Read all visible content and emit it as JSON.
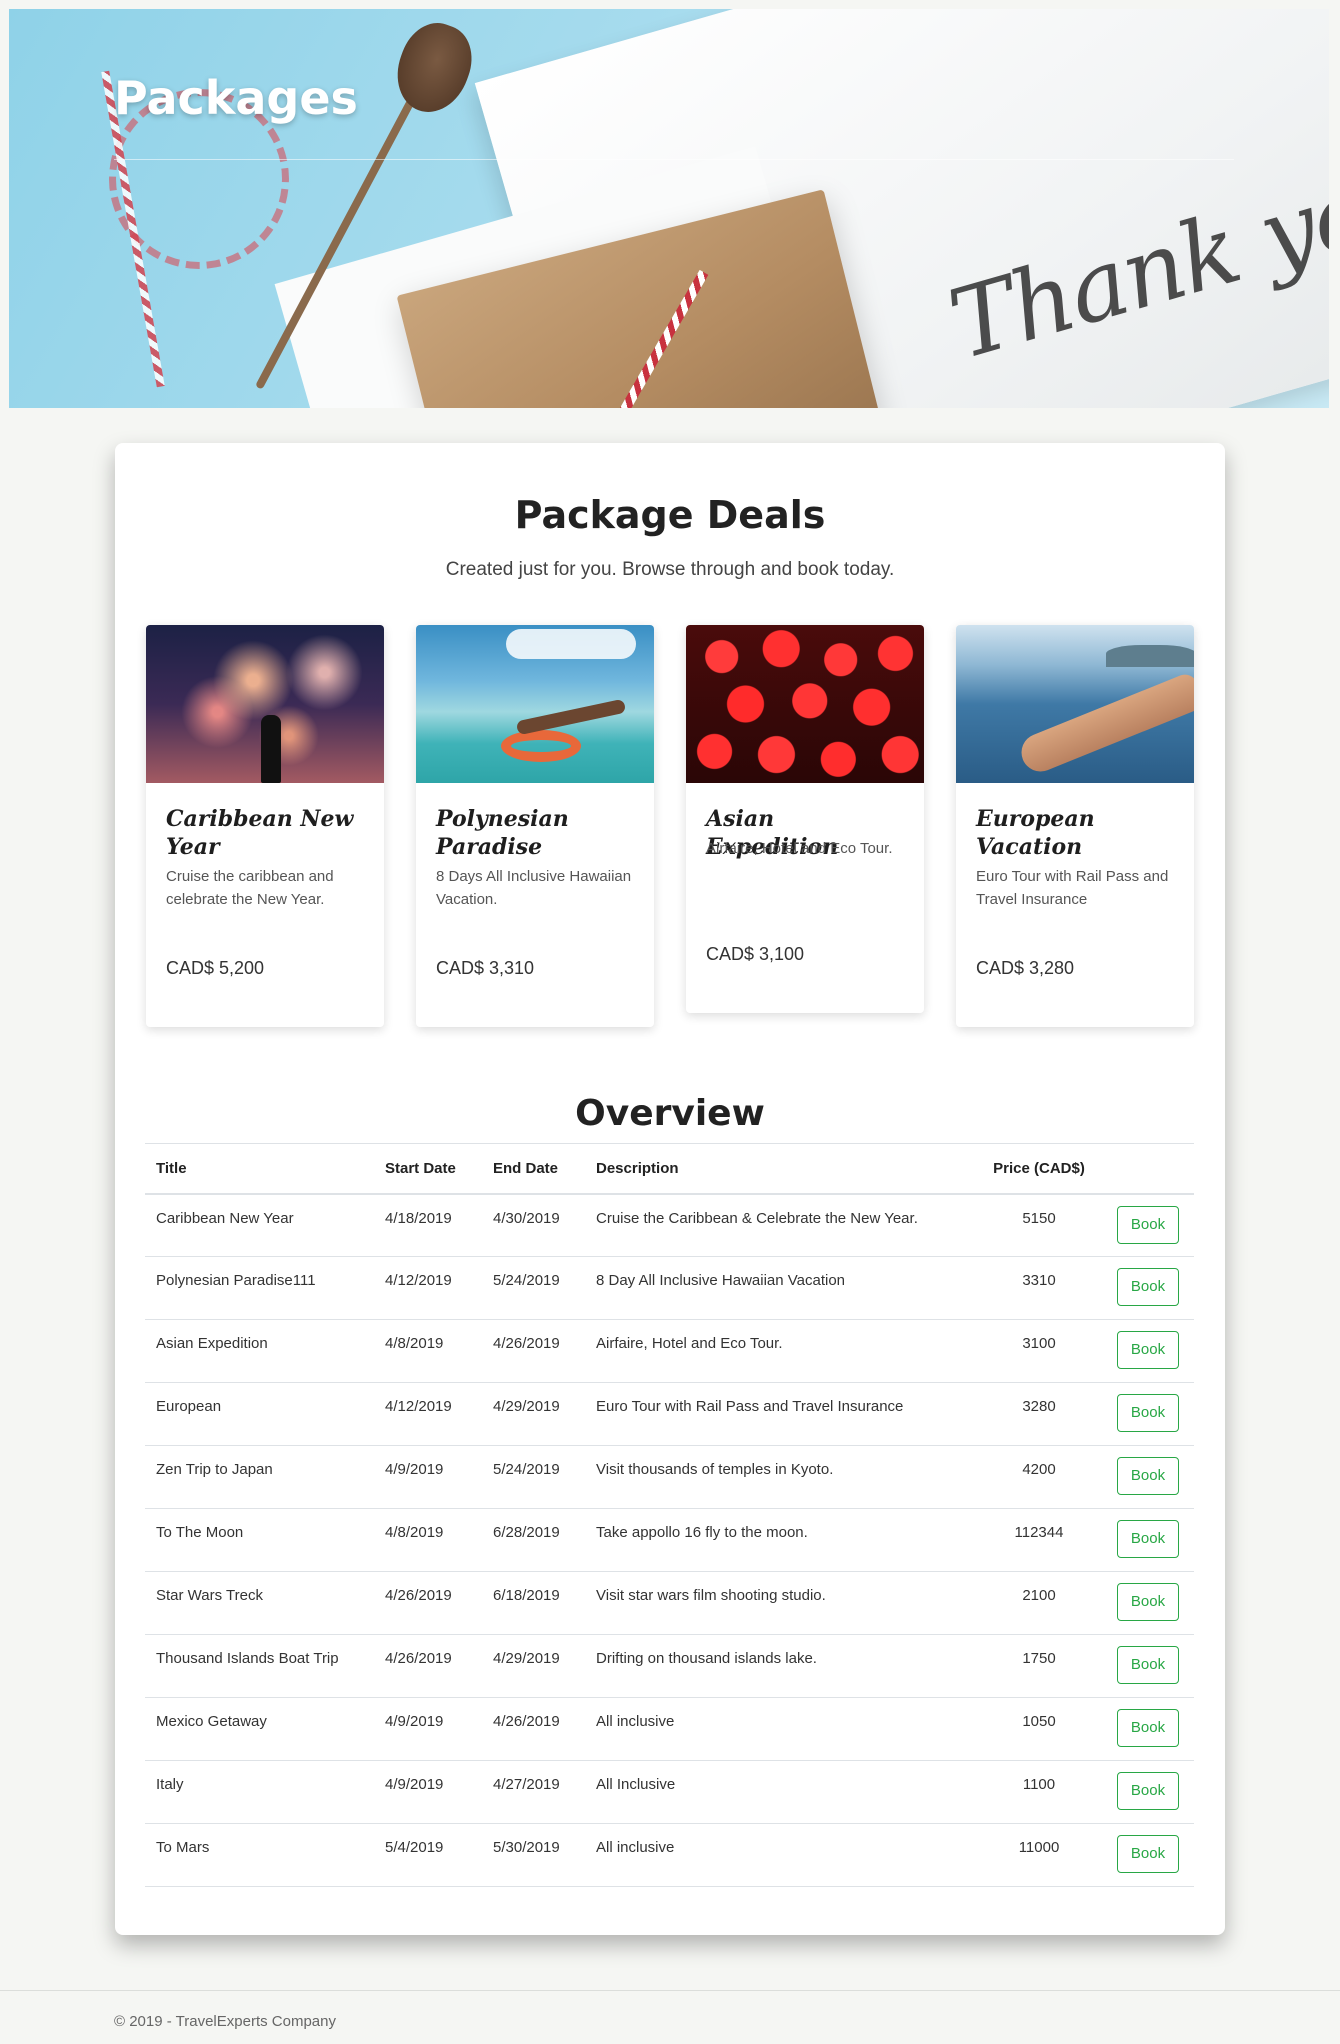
{
  "hero": {
    "title": "Packages"
  },
  "deals": {
    "heading": "Package Deals",
    "subtitle": "Created just for you. Browse through and book today."
  },
  "packages": [
    {
      "title": "Caribbean New Year",
      "description": "Cruise the caribbean and celebrate the New Year.",
      "price": "CAD$ 5,200",
      "image": "fireworks-photo"
    },
    {
      "title": "Polynesian Paradise",
      "description": "8 Days All Inclusive Hawaiian Vacation.",
      "price": "CAD$ 3,310",
      "image": "pool-float-photo"
    },
    {
      "title": "Asian Expedition",
      "description": "Airfaire, Hotel and Eco Tour.",
      "price": "CAD$ 3,100",
      "image": "red-lanterns-photo"
    },
    {
      "title": "European Vacation",
      "description": "Euro Tour with Rail Pass and Travel Insurance",
      "price": "CAD$ 3,280",
      "image": "sea-hand-photo"
    }
  ],
  "overview": {
    "heading": "Overview",
    "columns": [
      "Title",
      "Start Date",
      "End Date",
      "Description",
      "Price (CAD$)",
      ""
    ],
    "book_label": "Book",
    "rows": [
      {
        "title": "Caribbean New Year",
        "start": "4/18/2019",
        "end": "4/30/2019",
        "description": "Cruise the Caribbean & Celebrate the New Year.",
        "price": "5150"
      },
      {
        "title": "Polynesian Paradise111",
        "start": "4/12/2019",
        "end": "5/24/2019",
        "description": "8 Day All Inclusive Hawaiian Vacation",
        "price": "3310"
      },
      {
        "title": "Asian Expedition",
        "start": "4/8/2019",
        "end": "4/26/2019",
        "description": "Airfaire, Hotel and Eco Tour.",
        "price": "3100"
      },
      {
        "title": "European",
        "start": "4/12/2019",
        "end": "4/29/2019",
        "description": "Euro Tour with Rail Pass and Travel Insurance",
        "price": "3280"
      },
      {
        "title": "Zen Trip to Japan",
        "start": "4/9/2019",
        "end": "5/24/2019",
        "description": "Visit thousands of temples in Kyoto.",
        "price": "4200"
      },
      {
        "title": "To The Moon",
        "start": "4/8/2019",
        "end": "6/28/2019",
        "description": "Take appollo 16 fly to the moon.",
        "price": "112344"
      },
      {
        "title": "Star Wars Treck",
        "start": "4/26/2019",
        "end": "6/18/2019",
        "description": "Visit star wars film shooting studio.",
        "price": "2100"
      },
      {
        "title": "Thousand Islands Boat Trip",
        "start": "4/26/2019",
        "end": "4/29/2019",
        "description": "Drifting on thousand islands lake.",
        "price": "1750"
      },
      {
        "title": "Mexico Getaway",
        "start": "4/9/2019",
        "end": "4/26/2019",
        "description": "All inclusive",
        "price": "1050"
      },
      {
        "title": "Italy",
        "start": "4/9/2019",
        "end": "4/27/2019",
        "description": "All Inclusive",
        "price": "1100"
      },
      {
        "title": "To Mars",
        "start": "5/4/2019",
        "end": "5/30/2019",
        "description": "All inclusive",
        "price": "11000"
      }
    ]
  },
  "footer": {
    "text": "© 2019 - TravelExperts Company"
  },
  "colors": {
    "page_bg": "#f5f6f3",
    "book_button": "#28a745",
    "hero_sky": "#8fd2e8"
  }
}
